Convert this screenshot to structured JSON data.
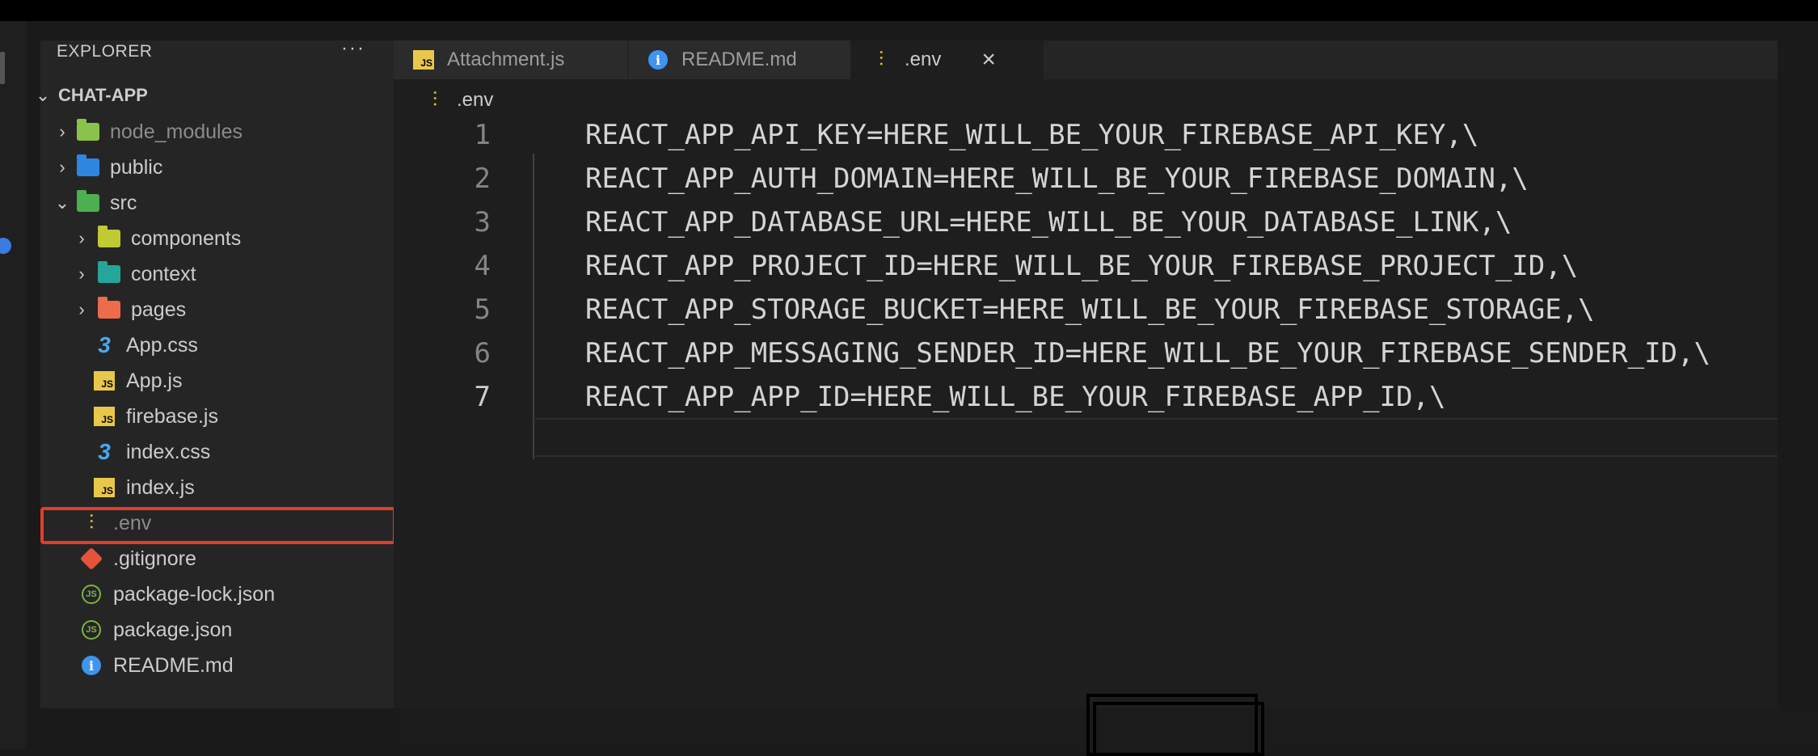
{
  "sidebar": {
    "title": "EXPLORER",
    "more_label": "···",
    "project": "CHAT-APP",
    "items": [
      {
        "label": "node_modules"
      },
      {
        "label": "public"
      },
      {
        "label": "src"
      },
      {
        "label": "components"
      },
      {
        "label": "context"
      },
      {
        "label": "pages"
      },
      {
        "label": "App.css"
      },
      {
        "label": "App.js"
      },
      {
        "label": "firebase.js"
      },
      {
        "label": "index.css"
      },
      {
        "label": "index.js"
      },
      {
        "label": ".env"
      },
      {
        "label": ".gitignore"
      },
      {
        "label": "package-lock.json"
      },
      {
        "label": "package.json"
      },
      {
        "label": "README.md"
      }
    ]
  },
  "tabs": [
    {
      "label": "Attachment.js",
      "icon": "js-file-icon"
    },
    {
      "label": "README.md",
      "icon": "info-icon"
    },
    {
      "label": ".env",
      "icon": "env-file-icon",
      "active": true
    }
  ],
  "breadcrumb": ".env",
  "editor": {
    "lines": [
      {
        "num": "1",
        "text": "REACT_APP_API_KEY=HERE_WILL_BE_YOUR_FIREBASE_API_KEY,\\"
      },
      {
        "num": "2",
        "text": "REACT_APP_AUTH_DOMAIN=HERE_WILL_BE_YOUR_FIREBASE_DOMAIN,\\"
      },
      {
        "num": "3",
        "text": "REACT_APP_DATABASE_URL=HERE_WILL_BE_YOUR_DATABASE_LINK,\\"
      },
      {
        "num": "4",
        "text": "REACT_APP_PROJECT_ID=HERE_WILL_BE_YOUR_FIREBASE_PROJECT_ID,\\"
      },
      {
        "num": "5",
        "text": "REACT_APP_STORAGE_BUCKET=HERE_WILL_BE_YOUR_FIREBASE_STORAGE,\\"
      },
      {
        "num": "6",
        "text": "REACT_APP_MESSAGING_SENDER_ID=HERE_WILL_BE_YOUR_FIREBASE_SENDER_ID,\\"
      },
      {
        "num": "7",
        "text": "REACT_APP_APP_ID=HERE_WILL_BE_YOUR_FIREBASE_APP_ID,\\"
      }
    ]
  },
  "colors": {
    "highlight_box": "#e13d2a",
    "js_badge": "#e8c84a",
    "env_icon": "#e2b93b"
  }
}
